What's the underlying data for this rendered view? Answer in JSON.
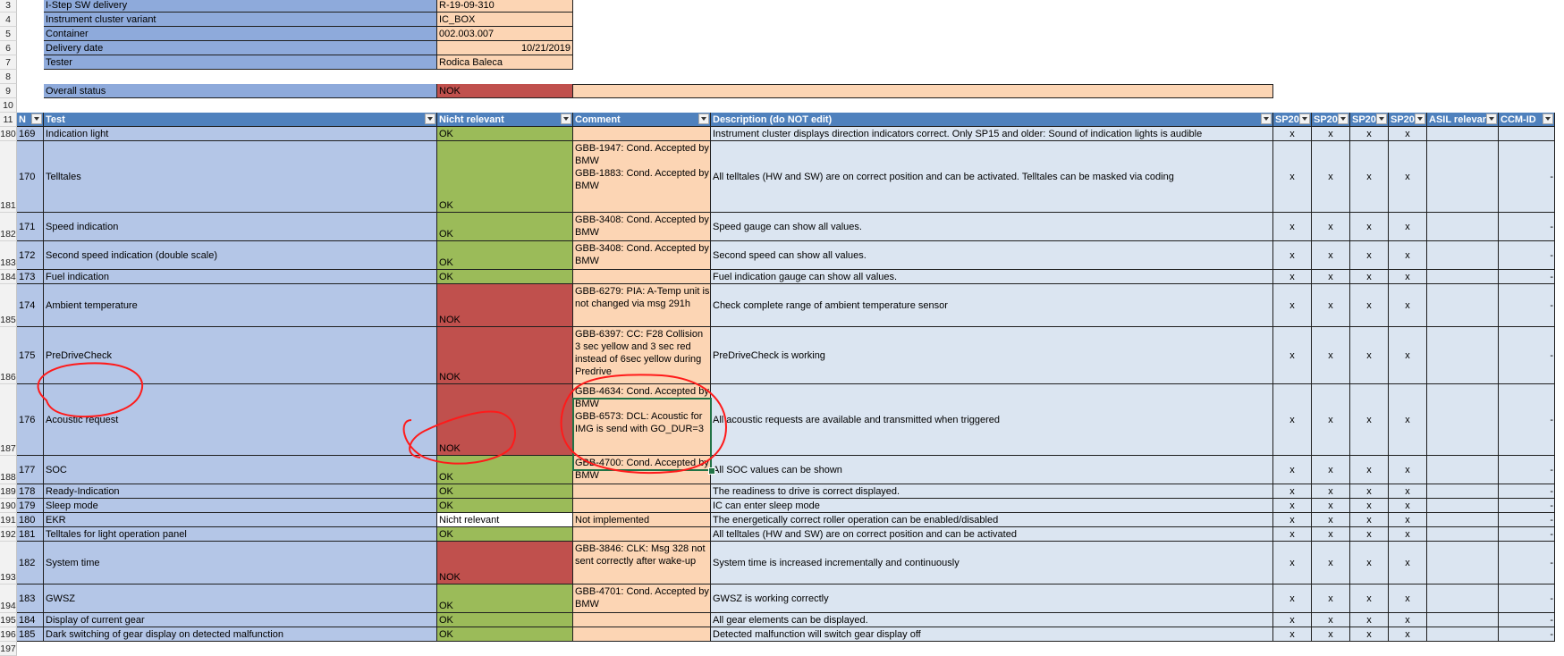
{
  "info_rows": [
    {
      "row_num": "3",
      "label": "I-Step SW delivery",
      "value": "R-19-09-310",
      "align": "left"
    },
    {
      "row_num": "4",
      "label": "Instrument cluster variant",
      "value": "IC_BOX",
      "align": "left"
    },
    {
      "row_num": "5",
      "label": "Container",
      "value": "002.003.007",
      "align": "left"
    },
    {
      "row_num": "6",
      "label": "Delivery date",
      "value": "10/21/2019",
      "align": "right"
    },
    {
      "row_num": "7",
      "label": "Tester",
      "value": "Rodica Baleca",
      "align": "left"
    }
  ],
  "empty_rows": [
    "8",
    "10"
  ],
  "overall": {
    "row_num": "9",
    "label": "Overall status",
    "value": "NOK"
  },
  "header": {
    "row_num": "11",
    "columns": [
      "N",
      "Test",
      "Nicht relevant",
      "Comment",
      "Description (do NOT edit)",
      "SP20",
      "SP20",
      "SP20",
      "SP20",
      "ASIL relevan",
      "CCM-ID"
    ]
  },
  "colors": {
    "ok_green": "#9bbb59",
    "nok_red": "#c0504d",
    "label_blue": "#b4c6e7",
    "comment_peach": "#fcd5b4",
    "header_blue": "#4f81bd",
    "annotation_red": "#ff1a1a"
  },
  "rows": [
    {
      "row_num": "180",
      "n": "169",
      "test": "Indication light",
      "status": "OK",
      "comment": "",
      "description": "Instrument cluster displays direction indicators correct. Only SP15 and older: Sound of indication lights is audible",
      "sp": [
        "x",
        "x",
        "x",
        "x"
      ],
      "ccm": ""
    },
    {
      "row_num": "181",
      "n": "170",
      "test": "Telltales",
      "status": "OK",
      "comment": "GBB-1947: Cond. Accepted by BMW\nGBB-1883: Cond. Accepted by BMW",
      "description": "All telltales (HW and SW) are on correct position and can be activated. Telltales can be masked via coding",
      "sp": [
        "x",
        "x",
        "x",
        "x"
      ],
      "ccm": "-"
    },
    {
      "row_num": "182",
      "n": "171",
      "test": "Speed indication",
      "status": "OK",
      "comment": "GBB-3408: Cond. Accepted by BMW",
      "description": "Speed gauge can show all values.",
      "sp": [
        "x",
        "x",
        "x",
        "x"
      ],
      "ccm": "-"
    },
    {
      "row_num": "183",
      "n": "172",
      "test": "Second speed indication (double scale)",
      "status": "OK",
      "comment": "GBB-3408: Cond. Accepted by BMW",
      "description": "Second speed can show all values.",
      "sp": [
        "x",
        "x",
        "x",
        "x"
      ],
      "ccm": "-"
    },
    {
      "row_num": "184",
      "n": "173",
      "test": "Fuel indication",
      "status": "OK",
      "comment": "",
      "description": "Fuel indication gauge can show all values.",
      "sp": [
        "x",
        "x",
        "x",
        "x"
      ],
      "ccm": "-"
    },
    {
      "row_num": "185",
      "n": "174",
      "test": "Ambient temperature",
      "status": "NOK",
      "comment": "GBB-6279: PIA: A-Temp unit is not changed via msg 291h",
      "description": "Check complete range of ambient temperature sensor",
      "sp": [
        "x",
        "x",
        "x",
        "x"
      ],
      "ccm": "-"
    },
    {
      "row_num": "186",
      "n": "175",
      "test": "PreDriveCheck",
      "status": "NOK",
      "comment": "GBB-6397: CC: F28 Collision 3 sec yellow and 3 sec red instead of 6sec yellow during Predrive",
      "description": "PreDriveCheck is working",
      "sp": [
        "x",
        "x",
        "x",
        "x"
      ],
      "ccm": "-"
    },
    {
      "row_num": "187",
      "n": "176",
      "test": "Acoustic request",
      "status": "NOK",
      "comment": "GBB-4634: Cond. Accepted by BMW\nGBB-6573: DCL: Acoustic for IMG is send with GO_DUR=3",
      "description": "All acoustic requests are available and transmitted when triggered",
      "sp": [
        "x",
        "x",
        "x",
        "x"
      ],
      "ccm": "-"
    },
    {
      "row_num": "188",
      "n": "177",
      "test": "SOC",
      "status": "OK",
      "comment": "GBB-4700: Cond. Accepted by BMW",
      "description": "All SOC values can be shown",
      "sp": [
        "x",
        "x",
        "x",
        "x"
      ],
      "ccm": "-"
    },
    {
      "row_num": "189",
      "n": "178",
      "test": "Ready-Indication",
      "status": "OK",
      "comment": "",
      "description": "The readiness to drive is correct displayed.",
      "sp": [
        "x",
        "x",
        "x",
        "x"
      ],
      "ccm": "-"
    },
    {
      "row_num": "190",
      "n": "179",
      "test": "Sleep mode",
      "status": "OK",
      "comment": "",
      "description": "IC can enter sleep mode",
      "sp": [
        "x",
        "x",
        "x",
        "x"
      ],
      "ccm": "-"
    },
    {
      "row_num": "191",
      "n": "180",
      "test": "EKR",
      "status": "Nicht relevant",
      "comment": "Not implemented",
      "description": "The energetically correct roller operation can be enabled/disabled",
      "sp": [
        "x",
        "x",
        "x",
        "x"
      ],
      "ccm": "-"
    },
    {
      "row_num": "192",
      "n": "181",
      "test": "Telltales for light operation panel",
      "status": "OK",
      "comment": "",
      "description": "All telltales (HW and SW) are on correct position and can be activated",
      "sp": [
        "x",
        "x",
        "x",
        "x"
      ],
      "ccm": "-"
    },
    {
      "row_num": "193",
      "n": "182",
      "test": "System time",
      "status": "NOK",
      "comment": "GBB-3846: CLK: Msg 328 not sent correctly after wake-up",
      "description": "System time is increased incrementally and continuously",
      "sp": [
        "x",
        "x",
        "x",
        "x"
      ],
      "ccm": "-"
    },
    {
      "row_num": "194",
      "n": "183",
      "test": "GWSZ",
      "status": "OK",
      "comment": "GBB-4701: Cond. Accepted by BMW",
      "description": "GWSZ is working correctly",
      "sp": [
        "x",
        "x",
        "x",
        "x"
      ],
      "ccm": "-"
    },
    {
      "row_num": "195",
      "n": "184",
      "test": "Display of current gear",
      "status": "OK",
      "comment": "",
      "description": "All gear elements can be displayed.",
      "sp": [
        "x",
        "x",
        "x",
        "x"
      ],
      "ccm": "-"
    },
    {
      "row_num": "196",
      "n": "185",
      "test": "Dark switching of gear display on detected malfunction",
      "status": "OK",
      "comment": "",
      "description": "Detected malfunction will switch gear display off",
      "sp": [
        "x",
        "x",
        "x",
        "x"
      ],
      "ccm": "-"
    }
  ],
  "last_row_num": "197"
}
